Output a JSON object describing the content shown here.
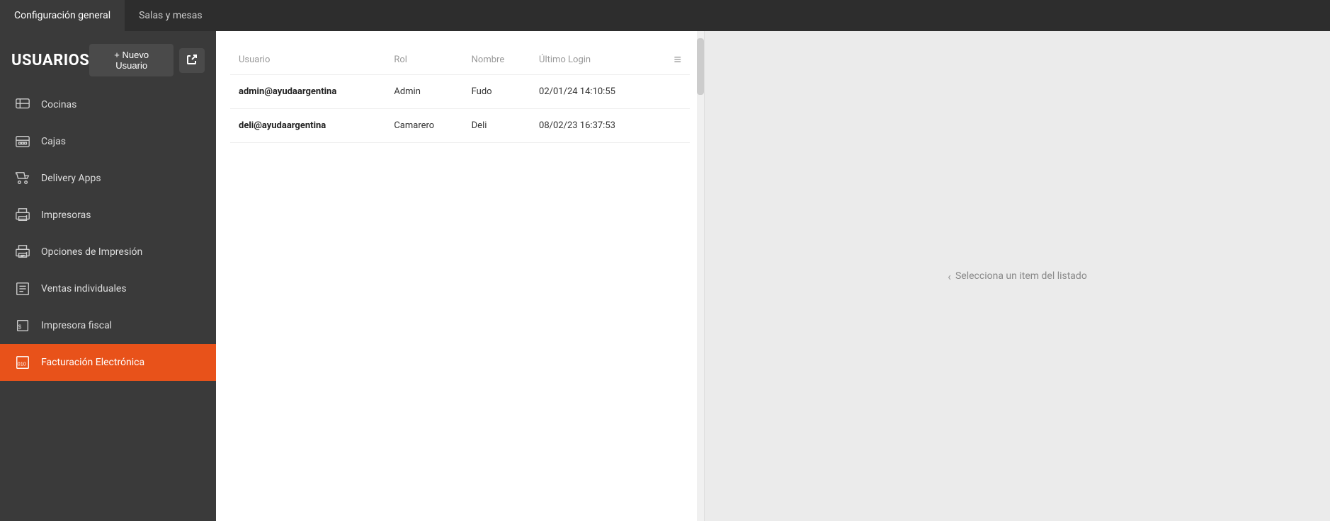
{
  "topNav": {
    "items": [
      {
        "label": "Configuración general",
        "active": true
      },
      {
        "label": "Salas y mesas",
        "active": false
      }
    ]
  },
  "sidebar": {
    "title": "USUARIOS",
    "buttons": {
      "nuevo_usuario": "+ Nuevo Usuario",
      "export": "↗"
    },
    "navItems": [
      {
        "label": "Cocinas",
        "icon": "kitchen",
        "active": false
      },
      {
        "label": "Cajas",
        "icon": "register",
        "active": false
      },
      {
        "label": "Delivery Apps",
        "icon": "delivery",
        "active": false
      },
      {
        "label": "Impresoras",
        "icon": "printer",
        "active": false
      },
      {
        "label": "Opciones de Impresión",
        "icon": "print-options",
        "active": false
      },
      {
        "label": "Ventas individuales",
        "icon": "sales",
        "active": false
      },
      {
        "label": "Impresora fiscal",
        "icon": "fiscal-printer",
        "active": false
      },
      {
        "label": "Facturación Electrónica",
        "icon": "electronic-billing",
        "active": false
      }
    ]
  },
  "table": {
    "columns": [
      {
        "key": "usuario",
        "label": "Usuario"
      },
      {
        "key": "rol",
        "label": "Rol"
      },
      {
        "key": "nombre",
        "label": "Nombre"
      },
      {
        "key": "ultimo_login",
        "label": "Último Login"
      }
    ],
    "rows": [
      {
        "usuario": "admin@ayudaargentina",
        "rol": "Admin",
        "nombre": "Fudo",
        "ultimo_login": "02/01/24 14:10:55"
      },
      {
        "usuario": "deli@ayudaargentina",
        "rol": "Camarero",
        "nombre": "Deli",
        "ultimo_login": "08/02/23 16:37:53"
      }
    ]
  },
  "detail": {
    "placeholder": "Selecciona un item del listado"
  }
}
